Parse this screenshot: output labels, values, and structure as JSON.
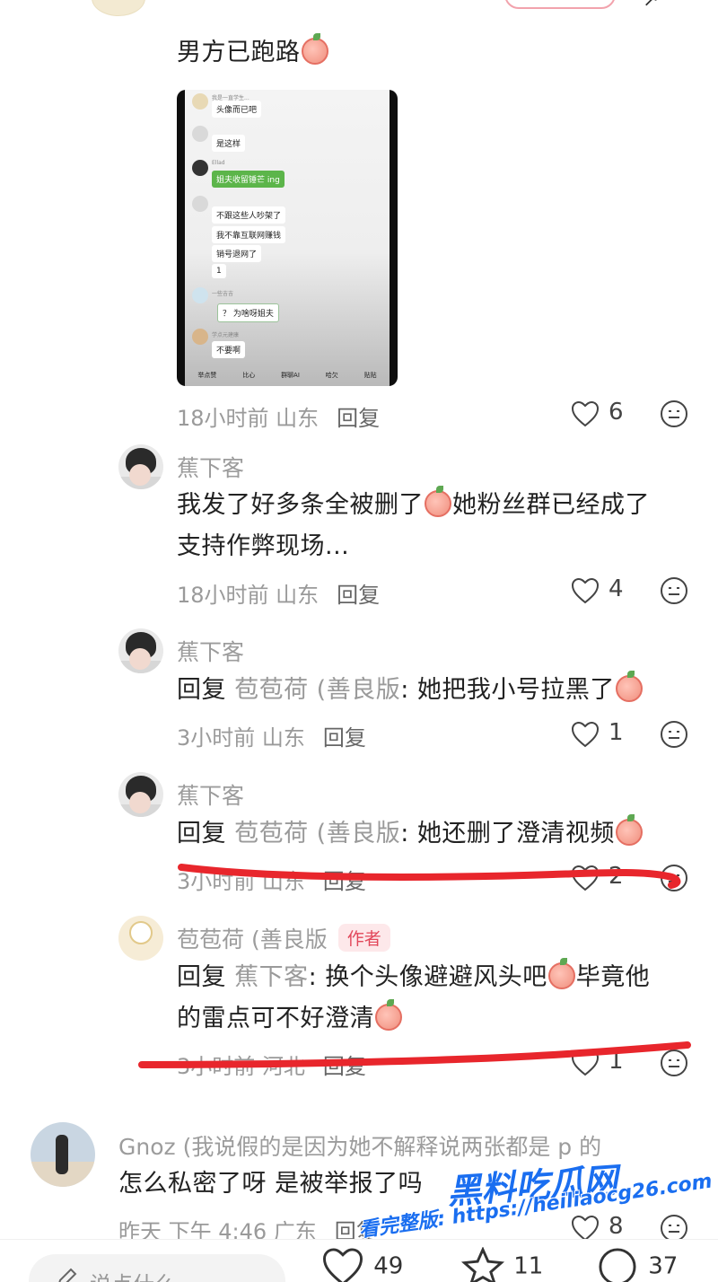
{
  "c1": {
    "text": "男方已跑路",
    "meta_time": "18小时前 山东",
    "reply": "回复",
    "likes": "6",
    "screenshot": {
      "rows": [
        "我是一直学生...",
        "头像而已吧",
        "是这样",
        "Ellad",
        "姐夫收留锤芒 ing",
        "不跟这些人吵架了",
        "我不靠互联网赚钱",
        "销号退网了",
        "1",
        "一些吉吉",
        "？ 为啥呀姐夫",
        "学点元建康",
        "不要啊"
      ],
      "bar": [
        "举点赞",
        "比心",
        "群聊AI",
        "哈欠",
        "贴贴"
      ]
    }
  },
  "c2": {
    "name": "蕉下客",
    "text_line1": "我发了好多条全被删了",
    "text_line1b": "她粉丝群已经成了",
    "text_line2": "支持作弊现场...",
    "meta_time": "18小时前 山东",
    "reply": "回复",
    "likes": "4"
  },
  "c3": {
    "name": "蕉下客",
    "prefix": "回复",
    "target": "苞苞荷 (善良版",
    "text": ": 她把我小号拉黑了",
    "meta_time": "3小时前 山东",
    "reply": "回复",
    "likes": "1"
  },
  "c4": {
    "name": "蕉下客",
    "prefix": "回复",
    "target": "苞苞荷 (善良版",
    "text": ": 她还删了澄清视频",
    "meta_time": "3小时前 山东",
    "reply": "回复",
    "likes": "2"
  },
  "c5": {
    "name": "苞苞荷 (善良版",
    "badge": "作者",
    "prefix": "回复",
    "target": "蕉下客",
    "text_line1": ": 换个头像避避风头吧",
    "text_line1b": "毕竟他",
    "text_line2": "的雷点可不好澄清",
    "meta_time": "3小时前 河北",
    "reply": "回复",
    "likes": "1"
  },
  "c6": {
    "name": "Gnoz (我说假的是因为她不解释说两张都是 p 的",
    "text": "怎么私密了呀 是被举报了吗",
    "meta_time": "昨天 下午 4:46 广东",
    "reply": "回复",
    "likes": "8"
  },
  "bottom": {
    "placeholder": "说点什么...",
    "like_count": "49",
    "star_count": "11",
    "comment_count": "37"
  },
  "watermark": {
    "brand": "黑料吃瓜网",
    "url": "看完整版: https://heiliaocg26.com"
  },
  "colors": {
    "accent": "#e2475a",
    "redline": "#e8262c",
    "watermark": "#1a6ef0"
  }
}
